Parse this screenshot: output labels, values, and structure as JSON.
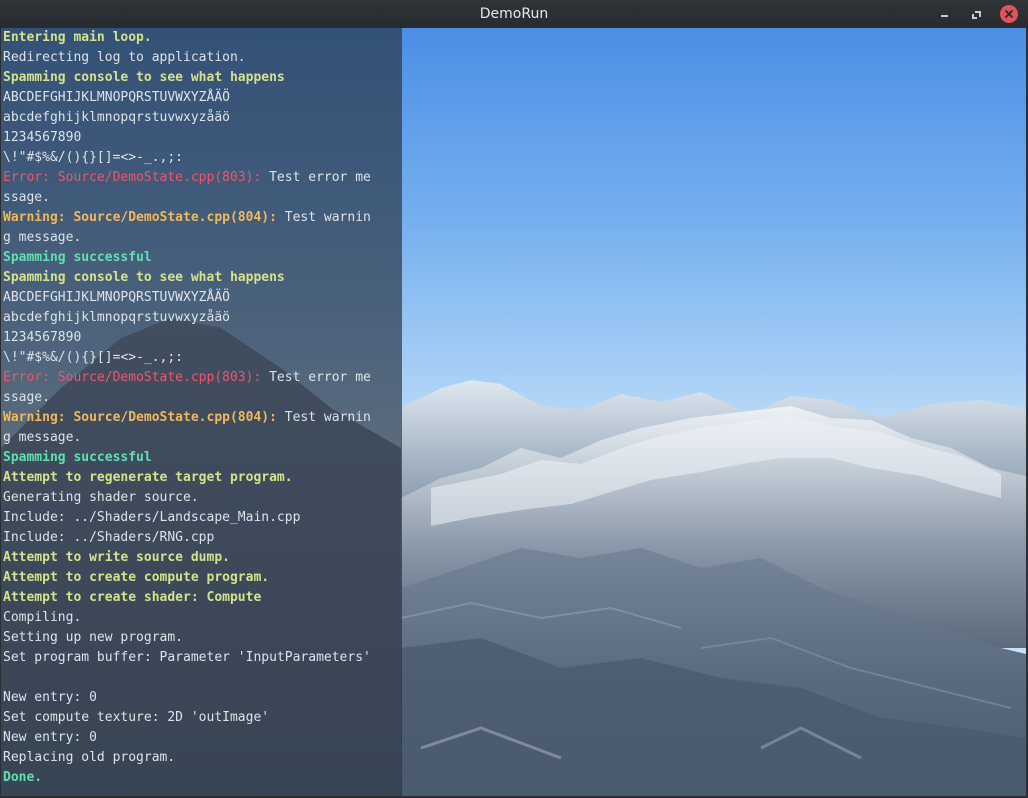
{
  "window": {
    "title": "DemoRun",
    "controls": {
      "minimize_icon": "minimize-icon",
      "maximize_icon": "maximize-icon",
      "close_icon": "close-icon",
      "close_color": "#e4535a"
    }
  },
  "colors": {
    "header": "#d4e38a",
    "success": "#5fe0b0",
    "error": "#f0556c",
    "warning": "#f2b85a",
    "normal": "#dde3e8",
    "console_bg": "#2a3442"
  },
  "console": {
    "lines": [
      [
        {
          "text": "Entering main loop.",
          "type": "header"
        }
      ],
      [
        {
          "text": "Redirecting log to application.",
          "type": "normal"
        }
      ],
      [
        {
          "text": "Spamming console to see what happens",
          "type": "header"
        }
      ],
      [
        {
          "text": "ABCDEFGHIJKLMNOPQRSTUVWXYZÅÄÖ",
          "type": "normal"
        }
      ],
      [
        {
          "text": "abcdefghijklmnopqrstuvwxyzåäö",
          "type": "normal"
        }
      ],
      [
        {
          "text": "1234567890",
          "type": "normal"
        }
      ],
      [
        {
          "text": "\\!\"#$%&/(){}[]=<>-_.,;:",
          "type": "normal"
        }
      ],
      [
        {
          "text": "Error: Source/DemoState.cpp(803): ",
          "type": "error"
        },
        {
          "text": "Test error me",
          "type": "errormsg"
        }
      ],
      [
        {
          "text": "ssage.",
          "type": "errormsg"
        }
      ],
      [
        {
          "text": "Warning: Source/DemoState.cpp(804): ",
          "type": "warning"
        },
        {
          "text": "Test warnin",
          "type": "warnmsg"
        }
      ],
      [
        {
          "text": "g message.",
          "type": "warnmsg"
        }
      ],
      [
        {
          "text": "Spamming successful",
          "type": "success"
        }
      ],
      [
        {
          "text": "Spamming console to see what happens",
          "type": "header"
        }
      ],
      [
        {
          "text": "ABCDEFGHIJKLMNOPQRSTUVWXYZÅÄÖ",
          "type": "normal"
        }
      ],
      [
        {
          "text": "abcdefghijklmnopqrstuvwxyzåäö",
          "type": "normal"
        }
      ],
      [
        {
          "text": "1234567890",
          "type": "normal"
        }
      ],
      [
        {
          "text": "\\!\"#$%&/(){}[]=<>-_.,;:",
          "type": "normal"
        }
      ],
      [
        {
          "text": "Error: Source/DemoState.cpp(803): ",
          "type": "error"
        },
        {
          "text": "Test error me",
          "type": "errormsg"
        }
      ],
      [
        {
          "text": "ssage.",
          "type": "errormsg"
        }
      ],
      [
        {
          "text": "Warning: Source/DemoState.cpp(804): ",
          "type": "warning"
        },
        {
          "text": "Test warnin",
          "type": "warnmsg"
        }
      ],
      [
        {
          "text": "g message.",
          "type": "warnmsg"
        }
      ],
      [
        {
          "text": "Spamming successful",
          "type": "success"
        }
      ],
      [
        {
          "text": "Attempt to regenerate target program.",
          "type": "header"
        }
      ],
      [
        {
          "text": "Generating shader source.",
          "type": "normal"
        }
      ],
      [
        {
          "text": "Include: ../Shaders/Landscape_Main.cpp",
          "type": "normal"
        }
      ],
      [
        {
          "text": "Include: ../Shaders/RNG.cpp",
          "type": "normal"
        }
      ],
      [
        {
          "text": "Attempt to write source dump.",
          "type": "header"
        }
      ],
      [
        {
          "text": "Attempt to create compute program.",
          "type": "header"
        }
      ],
      [
        {
          "text": "Attempt to create shader: Compute",
          "type": "header"
        }
      ],
      [
        {
          "text": "Compiling.",
          "type": "normal"
        }
      ],
      [
        {
          "text": "Setting up new program.",
          "type": "normal"
        }
      ],
      [
        {
          "text": "Set program buffer: Parameter 'InputParameters'",
          "type": "normal"
        }
      ],
      [
        {
          "text": "",
          "type": "normal"
        }
      ],
      [
        {
          "text": "New entry: 0",
          "type": "normal"
        }
      ],
      [
        {
          "text": "Set compute texture: 2D 'outImage'",
          "type": "normal"
        }
      ],
      [
        {
          "text": "New entry: 0",
          "type": "normal"
        }
      ],
      [
        {
          "text": "Replacing old program.",
          "type": "normal"
        }
      ],
      [
        {
          "text": "Done.",
          "type": "success"
        }
      ]
    ]
  }
}
